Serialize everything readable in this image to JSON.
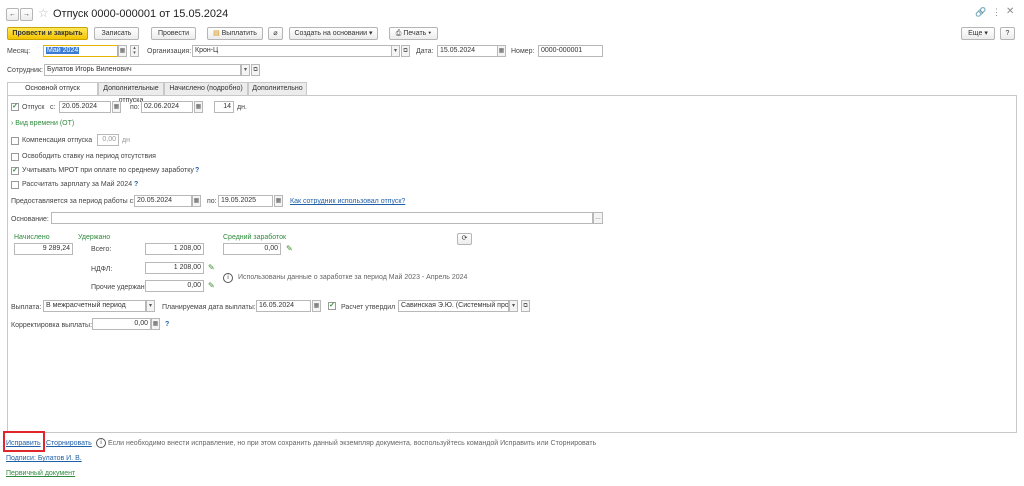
{
  "window": {
    "title": "Отпуск 0000-000001 от 15.05.2024"
  },
  "toolbar": {
    "post_close": "Провести и закрыть",
    "save": "Записать",
    "post": "Провести",
    "pay": "Выплатить",
    "create_based": "Создать на основании",
    "print": "Печать",
    "more": "Еще",
    "help": "?"
  },
  "header": {
    "month_label": "Месяц:",
    "month_value": "Май 2024",
    "org_label": "Организация:",
    "org_value": "Крон-Ц",
    "date_label": "Дата:",
    "date_value": "15.05.2024",
    "number_label": "Номер:",
    "number_value": "0000-000001",
    "employee_label": "Сотрудник:",
    "employee_value": "Булатов Игорь Виленович"
  },
  "tabs": [
    "Основной отпуск",
    "Дополнительные отпуска",
    "Начислено (подробно)",
    "Дополнительно"
  ],
  "main": {
    "vacation_label": "Отпуск",
    "from_label": "с:",
    "from_value": "20.05.2024",
    "to_label": "по:",
    "to_value": "02.06.2024",
    "days_value": "14",
    "days_unit": "дн.",
    "time_type": "Вид времени (ОТ)",
    "compensation_label": "Компенсация отпуска",
    "compensation_value": "0,00",
    "compensation_unit": "дн",
    "release_rate": "Освободить ставку на период отсутствия",
    "mrot": "Учитывать МРОТ при оплате по среднему заработку",
    "calc_salary": "Рассчитать зарплату за Май 2024",
    "period_label": "Предоставляется за период работы с:",
    "period_from": "20.05.2024",
    "period_to_label": "по:",
    "period_to": "19.05.2025",
    "how_used_link": "Как сотрудник использовал отпуск?",
    "basis_label": "Основание:",
    "basis_value": ""
  },
  "totals": {
    "accrued_header": "Начислено",
    "accrued_value": "9 289,24",
    "withheld_header": "Удержано",
    "total_label": "Всего:",
    "total_value": "1 208,00",
    "ndfl_label": "НДФЛ:",
    "ndfl_value": "1 208,00",
    "other_label": "Прочие удержания:",
    "other_value": "0,00",
    "avg_header": "Средний заработок",
    "avg_value": "0,00",
    "info_text": "Использованы данные о заработке за период Май 2023 - Апрель 2024"
  },
  "payment": {
    "payout_label": "Выплата:",
    "payout_value": "В межрасчетный период",
    "planned_label": "Планируемая дата выплаты:",
    "planned_value": "16.05.2024",
    "approved_label": "Расчет утвердил",
    "approved_value": "Савинская Э.Ю. (Системный прог",
    "correction_label": "Корректировка выплаты:",
    "correction_value": "0,00"
  },
  "footer": {
    "fix_link": "Исправить",
    "reverse_link": "Сторнировать",
    "info_text": "Если необходимо внести исправление, но при этом сохранить данный экземпляр документа, воспользуйтесь командой Исправить или Сторнировать",
    "signatures_link": "Подписи: Булатов И. В.",
    "primary_doc_link": "Первичный документ"
  }
}
